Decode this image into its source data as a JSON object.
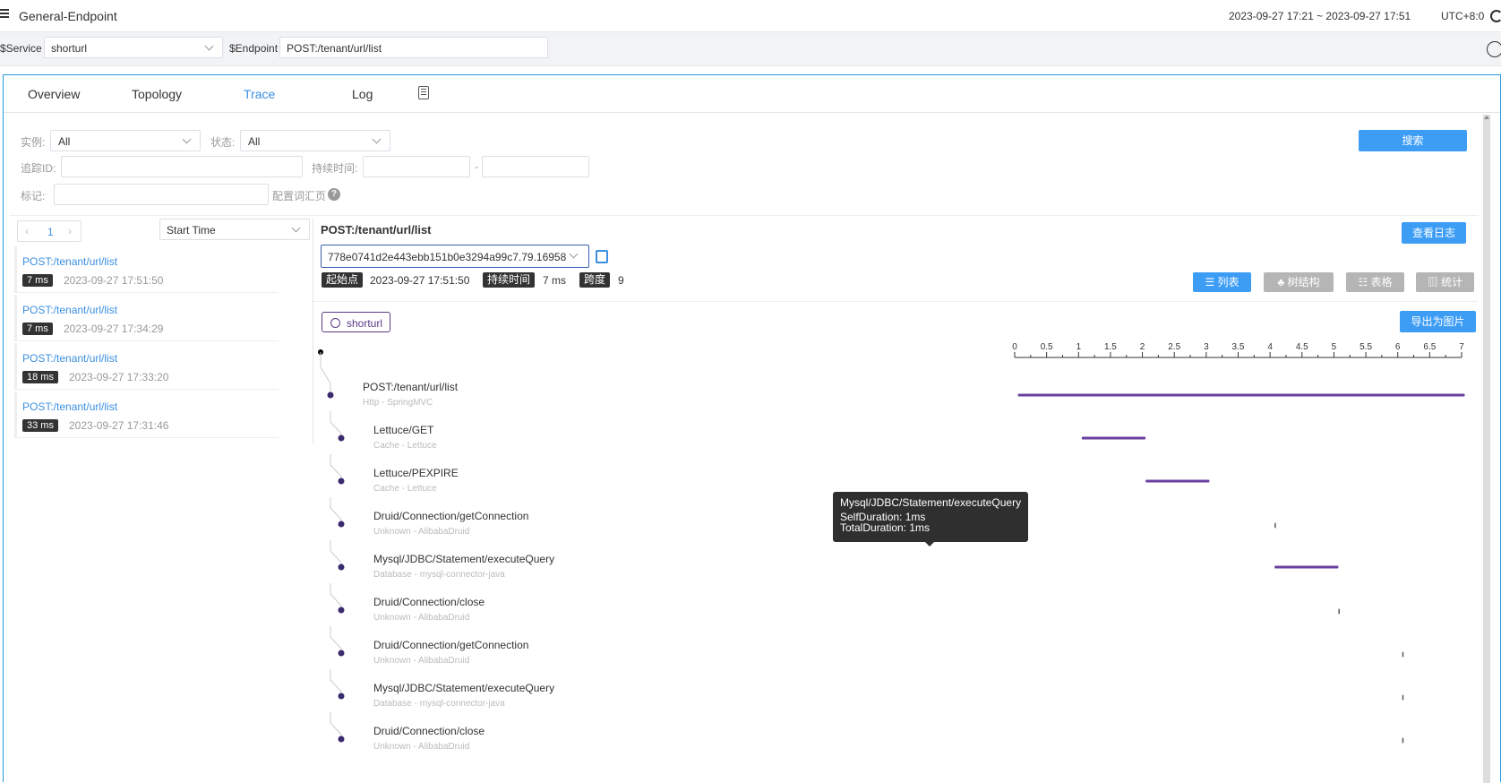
{
  "header": {
    "title": "General-Endpoint",
    "time_range": "2023-09-27 17:21 ~ 2023-09-27 17:51",
    "timezone": "UTC+8:0"
  },
  "filters": {
    "service_label": "$Service",
    "service_value": "shorturl",
    "endpoint_label": "$Endpoint",
    "endpoint_value": "POST:/tenant/url/list"
  },
  "tabs": [
    "Overview",
    "Topology",
    "Trace",
    "Log"
  ],
  "active_tab": "Trace",
  "search": {
    "instance_label": "实例:",
    "instance_value": "All",
    "status_label": "状态:",
    "status_value": "All",
    "trace_id_label": "追踪ID:",
    "duration_label": "持续时间:",
    "duration_sep": "-",
    "tags_label": "标记:",
    "config_link": "配置词汇页",
    "search_button": "搜索"
  },
  "trace_list": {
    "page": "1",
    "sort": "Start Time",
    "items": [
      {
        "endpoint": "POST:/tenant/url/list",
        "duration": "7 ms",
        "time": "2023-09-27 17:51:50"
      },
      {
        "endpoint": "POST:/tenant/url/list",
        "duration": "7 ms",
        "time": "2023-09-27 17:34:29"
      },
      {
        "endpoint": "POST:/tenant/url/list",
        "duration": "18 ms",
        "time": "2023-09-27 17:33:20"
      },
      {
        "endpoint": "POST:/tenant/url/list",
        "duration": "33 ms",
        "time": "2023-09-27 17:31:46"
      }
    ]
  },
  "detail": {
    "title": "POST:/tenant/url/list",
    "view_logs_button": "查看日志",
    "trace_id": "778e0741d2e443ebb151b0e3294a99c7.79.16958",
    "start_label": "起始点",
    "start_value": "2023-09-27 17:51:50",
    "duration_label": "持续时间",
    "duration_value": "7 ms",
    "span_label": "跨度",
    "span_value": "9",
    "views": [
      "列表",
      "树结构",
      "表格",
      "统计"
    ],
    "active_view": "列表",
    "export_button": "导出为图片",
    "service": "shorturl"
  },
  "timeline": {
    "ticks": [
      "0",
      "0.5",
      "1",
      "1.5",
      "2",
      "2.5",
      "3",
      "3.5",
      "4",
      "4.5",
      "5",
      "5.5",
      "6",
      "6.5",
      "7"
    ],
    "max": 7,
    "bar_color": "#6a3fa0"
  },
  "spans": [
    {
      "name": "POST:/tenant/url/list",
      "sub": "Http - SpringMVC",
      "level": 0,
      "start": 0.05,
      "end": 7.05
    },
    {
      "name": "Lettuce/GET",
      "sub": "Cache - Lettuce",
      "level": 1,
      "start": 1.05,
      "end": 2.05
    },
    {
      "name": "Lettuce/PEXPIRE",
      "sub": "Cache - Lettuce",
      "level": 1,
      "start": 2.05,
      "end": 3.05
    },
    {
      "name": "Druid/Connection/getConnection",
      "sub": "Unknown - AlibabaDruid",
      "level": 1,
      "start": 4.07,
      "end": 4.07
    },
    {
      "name": "Mysql/JDBC/Statement/executeQuery",
      "sub": "Database - mysql-connector-java",
      "level": 1,
      "start": 4.07,
      "end": 5.07
    },
    {
      "name": "Druid/Connection/close",
      "sub": "Unknown - AlibabaDruid",
      "level": 1,
      "start": 5.07,
      "end": 5.07
    },
    {
      "name": "Druid/Connection/getConnection",
      "sub": "Unknown - AlibabaDruid",
      "level": 1,
      "start": 6.07,
      "end": 6.07
    },
    {
      "name": "Mysql/JDBC/Statement/executeQuery",
      "sub": "Database - mysql-connector-java",
      "level": 1,
      "start": 6.07,
      "end": 6.07
    },
    {
      "name": "Druid/Connection/close",
      "sub": "Unknown - AlibabaDruid",
      "level": 1,
      "start": 6.07,
      "end": 6.07
    }
  ],
  "tooltip": {
    "title": "Mysql/JDBC/Statement/executeQuery",
    "self": "SelfDuration: 1ms",
    "total": "TotalDuration: 1ms"
  }
}
